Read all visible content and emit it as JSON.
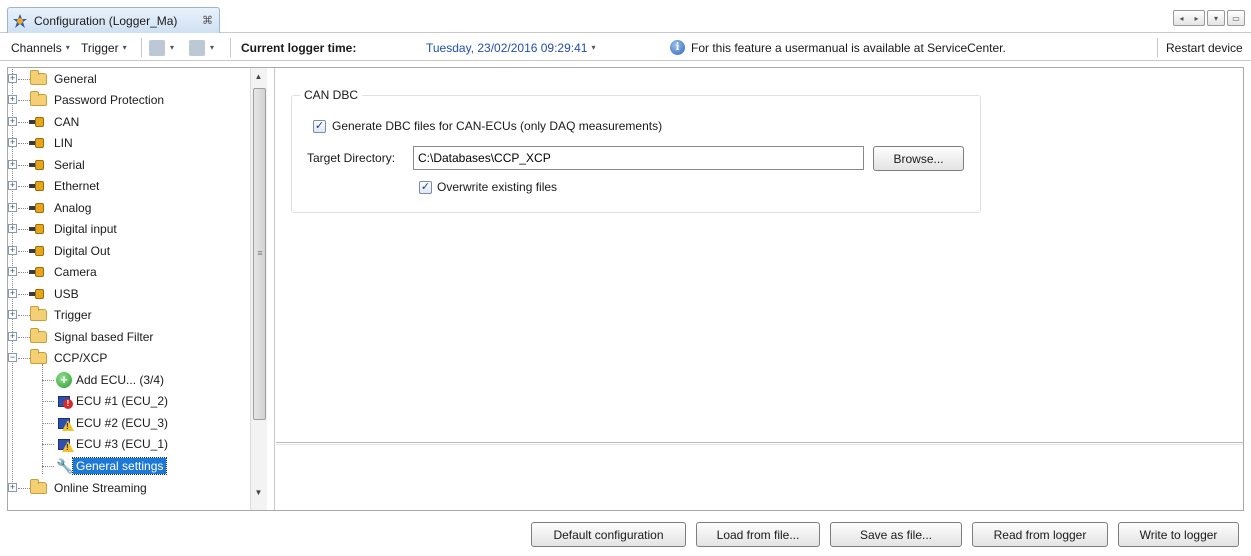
{
  "tab": {
    "title": "Configuration (Logger_Ma)",
    "close": "⌘",
    "app_icon": "gear-star-icon"
  },
  "window_buttons": {
    "nav": [
      "◂",
      "▸"
    ],
    "dropdown": "▾",
    "restore": "▭"
  },
  "toolbar": {
    "channels": "Channels",
    "trigger": "Trigger",
    "current_time_label": "Current logger time:",
    "current_time_value": "Tuesday, 23/02/2016 09:29:41",
    "info_text": "For this feature a usermanual is available at ServiceCenter.",
    "restart": "Restart device",
    "caret": "▾",
    "info_icon": "i"
  },
  "tree": {
    "items": [
      {
        "label": "General",
        "icon": "folder-icon"
      },
      {
        "label": "Password Protection",
        "icon": "folder-icon"
      },
      {
        "label": "CAN",
        "icon": "plug-icon"
      },
      {
        "label": "LIN",
        "icon": "plug-icon"
      },
      {
        "label": "Serial",
        "icon": "plug-icon"
      },
      {
        "label": "Ethernet",
        "icon": "plug-icon"
      },
      {
        "label": "Analog",
        "icon": "plug-icon"
      },
      {
        "label": "Digital input",
        "icon": "plug-icon"
      },
      {
        "label": "Digital Out",
        "icon": "plug-icon"
      },
      {
        "label": "Camera",
        "icon": "plug-icon"
      },
      {
        "label": "USB",
        "icon": "plug-icon"
      },
      {
        "label": "Trigger",
        "icon": "folder-icon"
      },
      {
        "label": "Signal based Filter",
        "icon": "folder-icon"
      },
      {
        "label": "CCP/XCP",
        "icon": "folder-icon",
        "expanded": true
      }
    ],
    "ccp_children": [
      {
        "label": "Add ECU... (3/4)",
        "icon": "add-icon"
      },
      {
        "label": "ECU #1 (ECU_2)",
        "icon": "ecu-error-icon"
      },
      {
        "label": "ECU #2 (ECU_3)",
        "icon": "ecu-warning-icon"
      },
      {
        "label": "ECU #3 (ECU_1)",
        "icon": "ecu-warning-icon"
      },
      {
        "label": "General settings",
        "icon": "wrench-icon",
        "selected": true
      }
    ],
    "after": [
      {
        "label": "Online Streaming",
        "icon": "folder-icon"
      }
    ],
    "expand_glyph": "+",
    "collapse_glyph": "−"
  },
  "can_dbc": {
    "group_title": "CAN DBC",
    "generate_label": "Generate DBC files for CAN-ECUs (only DAQ measurements)",
    "generate_checked": true,
    "target_label": "Target Directory:",
    "target_value": "C:\\Databases\\CCP_XCP",
    "browse": "Browse...",
    "overwrite_label": "Overwrite existing files",
    "overwrite_checked": true,
    "check_glyph": "✓"
  },
  "footer": {
    "default_config": "Default configuration",
    "load": "Load from file...",
    "save": "Save as file...",
    "read": "Read from logger",
    "write": "Write to logger"
  },
  "scroll": {
    "up": "▲",
    "down": "▼",
    "grip": "≡"
  },
  "colors": {
    "selection": "#1e78d6",
    "time_text": "#1f4fb3",
    "folder": "#f4cf74"
  }
}
